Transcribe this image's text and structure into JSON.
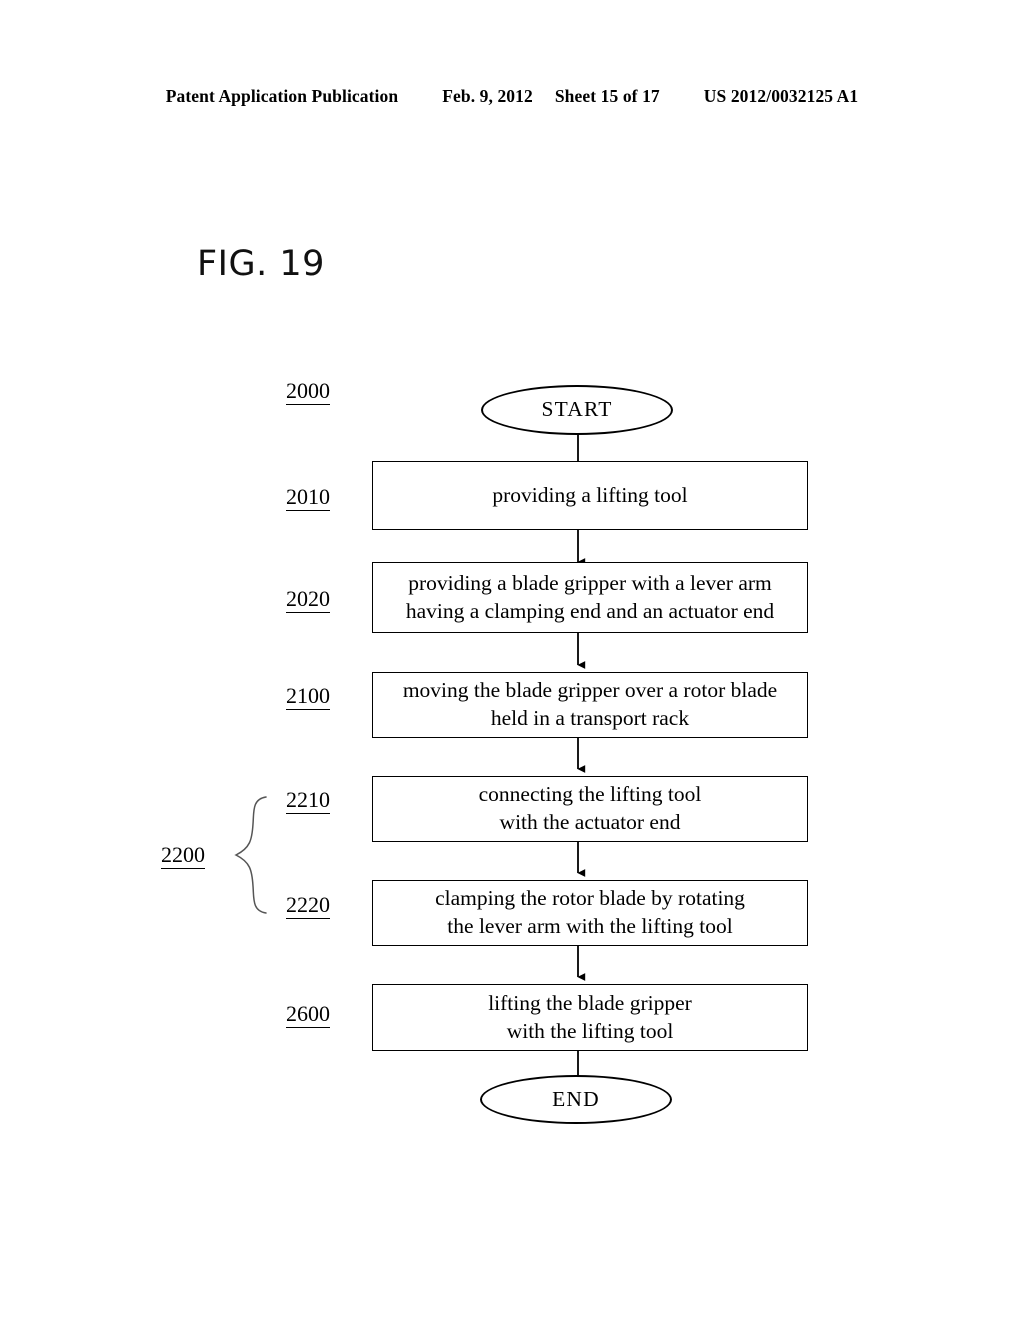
{
  "header": {
    "publication": "Patent Application Publication",
    "date": "Feb. 9, 2012",
    "sheet": "Sheet 15 of 17",
    "document_number": "US 2012/0032125 A1"
  },
  "figure": {
    "title": "FIG. 19"
  },
  "flowchart": {
    "start": {
      "ref": "2000",
      "label": "START"
    },
    "end": {
      "label": "END"
    },
    "group": {
      "ref": "2200"
    },
    "steps": [
      {
        "ref": "2010",
        "lines": [
          "providing a lifting tool"
        ]
      },
      {
        "ref": "2020",
        "lines": [
          "providing a blade gripper with a lever arm",
          "having a clamping end and an actuator end"
        ]
      },
      {
        "ref": "2100",
        "lines": [
          "moving the blade gripper over a rotor blade",
          "held in a transport rack"
        ]
      },
      {
        "ref": "2210",
        "lines": [
          "connecting the lifting tool",
          "with the actuator end"
        ]
      },
      {
        "ref": "2220",
        "lines": [
          "clamping the rotor blade by rotating",
          "the lever arm with the lifting tool"
        ]
      },
      {
        "ref": "2600",
        "lines": [
          "lifting the blade gripper",
          "with the lifting tool"
        ]
      }
    ]
  }
}
